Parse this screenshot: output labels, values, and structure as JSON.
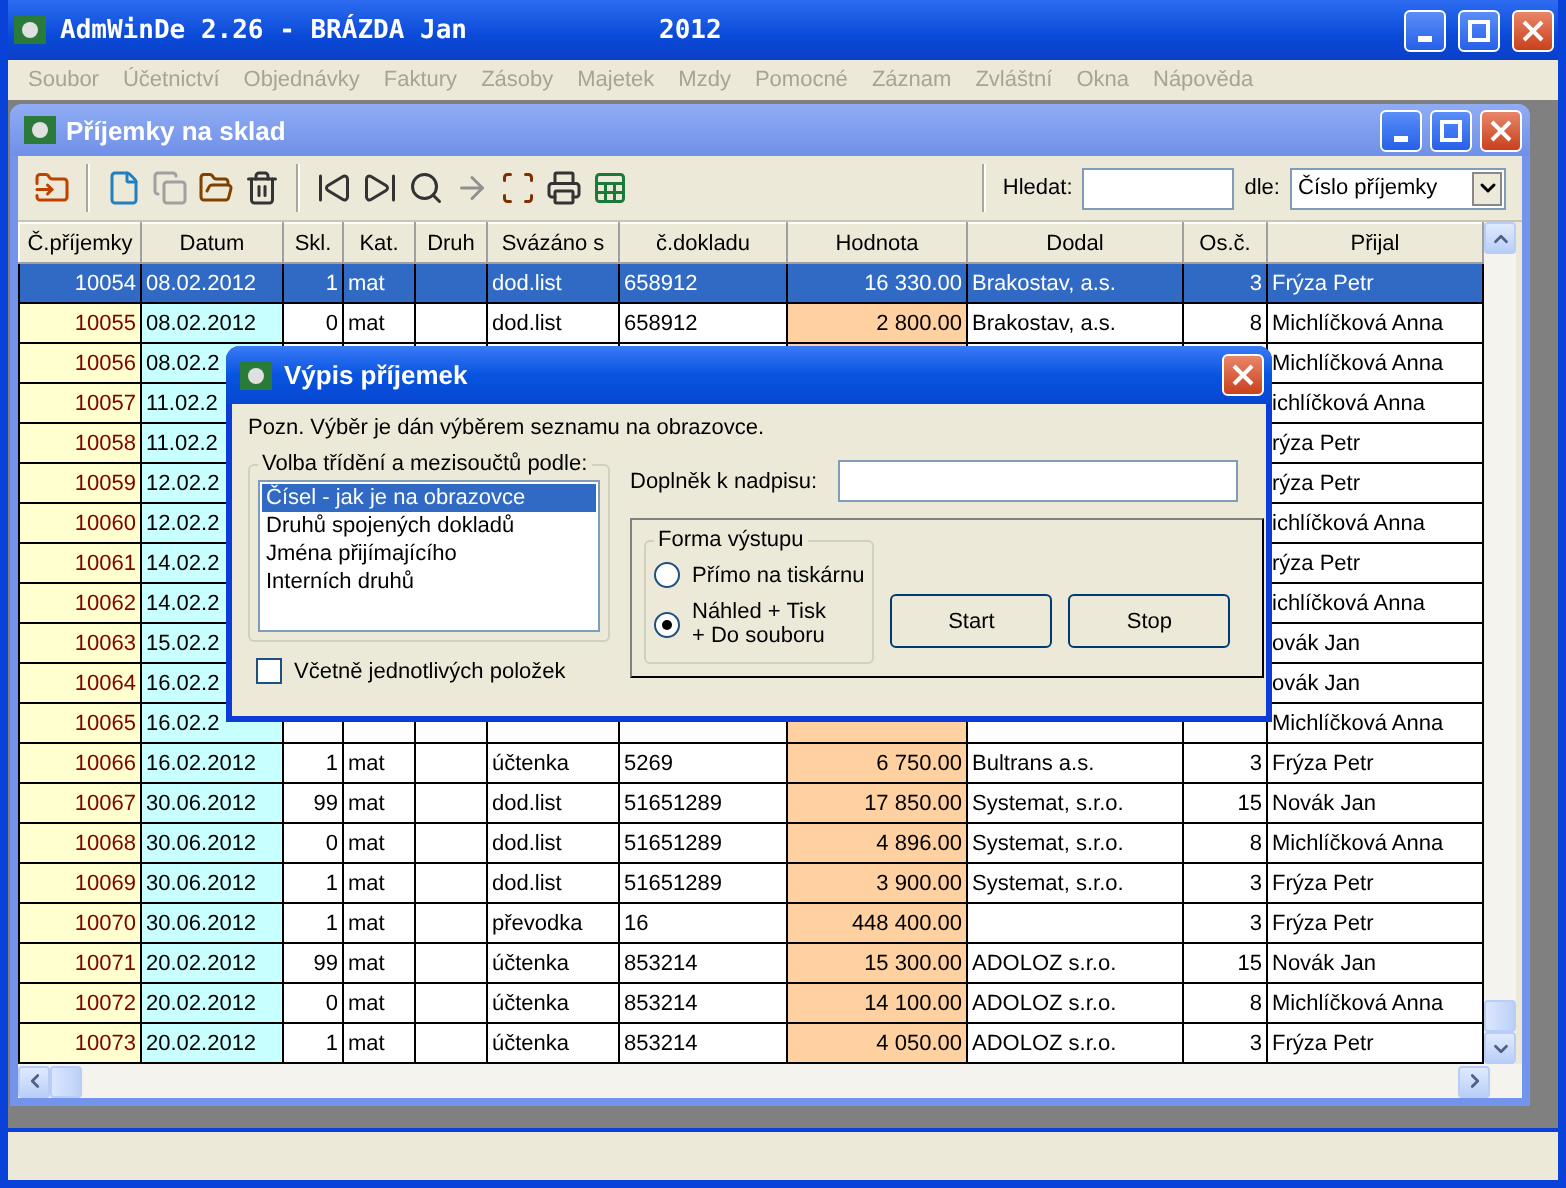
{
  "window": {
    "title": "AdmWinDe 2.26 - BRÁZDA Jan",
    "year": "2012"
  },
  "menu": [
    {
      "label": "Soubor",
      "disabled": true
    },
    {
      "label": "Účetnictví",
      "disabled": true
    },
    {
      "label": "Objednávky",
      "disabled": true
    },
    {
      "label": "Faktury",
      "disabled": true
    },
    {
      "label": "Zásoby",
      "disabled": true
    },
    {
      "label": "Majetek",
      "disabled": true
    },
    {
      "label": "Mzdy",
      "disabled": true
    },
    {
      "label": "Pomocné",
      "disabled": true
    },
    {
      "label": "Záznam",
      "disabled": true
    },
    {
      "label": "Zvláštní",
      "disabled": true
    },
    {
      "label": "Okna",
      "disabled": true
    },
    {
      "label": "Nápověda",
      "disabled": true
    }
  ],
  "child_window": {
    "title": "Příjemky na sklad"
  },
  "search": {
    "label": "Hledat:",
    "by_label": "dle:",
    "by_value": "Číslo příjemky"
  },
  "table": {
    "columns": [
      "Č.příjemky",
      "Datum",
      "Skl.",
      "Kat.",
      "Druh",
      "Svázáno s",
      "č.dokladu",
      "Hodnota",
      "Dodal",
      "Os.č.",
      "Přijal"
    ],
    "rows": [
      {
        "selected": true,
        "number": "10054",
        "date": "08.02.2012",
        "warehouse": "1",
        "category": "mat",
        "linked_to": "dod.list",
        "document_no": "658912",
        "value": "16 330.00",
        "supplier": "Brakostav, a.s.",
        "person_no": "3",
        "received_by": "Frýza Petr"
      },
      {
        "selected": false,
        "number": "10055",
        "date": "08.02.2012",
        "warehouse": "0",
        "category": "mat",
        "linked_to": "dod.list",
        "document_no": "658912",
        "value": "2 800.00",
        "supplier": "Brakostav, a.s.",
        "person_no": "8",
        "received_by": "Michlíčková Anna"
      },
      {
        "selected": false,
        "number": "10056",
        "date": "08.02.2",
        "received_by": "Michlíčková Anna"
      },
      {
        "selected": false,
        "number": "10057",
        "date": "11.02.2",
        "received_by": "ichlíčková Anna"
      },
      {
        "selected": false,
        "number": "10058",
        "date": "11.02.2",
        "received_by": "rýza Petr"
      },
      {
        "selected": false,
        "number": "10059",
        "date": "12.02.2",
        "received_by": "rýza Petr"
      },
      {
        "selected": false,
        "number": "10060",
        "date": "12.02.2",
        "received_by": "ichlíčková Anna"
      },
      {
        "selected": false,
        "number": "10061",
        "date": "14.02.2",
        "received_by": "rýza Petr"
      },
      {
        "selected": false,
        "number": "10062",
        "date": "14.02.2",
        "received_by": "ichlíčková Anna"
      },
      {
        "selected": false,
        "number": "10063",
        "date": "15.02.2",
        "received_by": "ovák Jan"
      },
      {
        "selected": false,
        "number": "10064",
        "date": "16.02.2",
        "received_by": "ovák Jan"
      },
      {
        "selected": false,
        "number": "10065",
        "date": "16.02.2",
        "received_by": "Michlíčková Anna"
      },
      {
        "selected": false,
        "number": "10066",
        "date": "16.02.2012",
        "warehouse": "1",
        "category": "mat",
        "linked_to": "účtenka",
        "document_no": "5269",
        "value": "6 750.00",
        "supplier": "Bultrans a.s.",
        "person_no": "3",
        "received_by": "Frýza Petr"
      },
      {
        "selected": false,
        "number": "10067",
        "date": "30.06.2012",
        "warehouse": "99",
        "category": "mat",
        "linked_to": "dod.list",
        "document_no": "51651289",
        "value": "17 850.00",
        "supplier": "Systemat, s.r.o.",
        "person_no": "15",
        "received_by": "Novák Jan"
      },
      {
        "selected": false,
        "number": "10068",
        "date": "30.06.2012",
        "warehouse": "0",
        "category": "mat",
        "linked_to": "dod.list",
        "document_no": "51651289",
        "value": "4 896.00",
        "supplier": "Systemat, s.r.o.",
        "person_no": "8",
        "received_by": "Michlíčková Anna"
      },
      {
        "selected": false,
        "number": "10069",
        "date": "30.06.2012",
        "warehouse": "1",
        "category": "mat",
        "linked_to": "dod.list",
        "document_no": "51651289",
        "value": "3 900.00",
        "supplier": "Systemat, s.r.o.",
        "person_no": "3",
        "received_by": "Frýza Petr"
      },
      {
        "selected": false,
        "number": "10070",
        "date": "30.06.2012",
        "warehouse": "1",
        "category": "mat",
        "linked_to": "převodka",
        "document_no": "16",
        "value": "448 400.00",
        "person_no": "3",
        "received_by": "Frýza Petr"
      },
      {
        "selected": false,
        "number": "10071",
        "date": "20.02.2012",
        "warehouse": "99",
        "category": "mat",
        "linked_to": "účtenka",
        "document_no": "853214",
        "value": "15 300.00",
        "supplier": "ADOLOZ s.r.o.",
        "person_no": "15",
        "received_by": "Novák Jan"
      },
      {
        "selected": false,
        "number": "10072",
        "date": "20.02.2012",
        "warehouse": "0",
        "category": "mat",
        "linked_to": "účtenka",
        "document_no": "853214",
        "value": "14 100.00",
        "supplier": "ADOLOZ s.r.o.",
        "person_no": "8",
        "received_by": "Michlíčková Anna"
      },
      {
        "selected": false,
        "number": "10073",
        "date": "20.02.2012",
        "warehouse": "1",
        "category": "mat",
        "linked_to": "účtenka",
        "document_no": "853214",
        "value": "4 050.00",
        "supplier": "ADOLOZ s.r.o.",
        "person_no": "3",
        "received_by": "Frýza Petr"
      }
    ]
  },
  "dialog": {
    "title": "Výpis příjemek",
    "note": "Pozn. Výběr je dán výběrem seznamu na obrazovce.",
    "sort_group": {
      "legend": "Volba třídění a mezisoučtů podle:",
      "options": [
        {
          "label": "Čísel - jak je na obrazovce",
          "selected": true
        },
        {
          "label": "Druhů spojených dokladů",
          "selected": false
        },
        {
          "label": "Jména přijímajícího",
          "selected": false
        },
        {
          "label": "Interních druhů",
          "selected": false
        }
      ]
    },
    "include_items": {
      "label": "Včetně jednotlivých položek",
      "checked": false
    },
    "heading_suffix": {
      "label": "Doplněk k nadpisu:"
    },
    "output": {
      "legend": "Forma výstupu",
      "options": [
        {
          "label": "Přímo na tiskárnu",
          "selected": false
        },
        {
          "label": "Náhled + Tisk\n+ Do souboru",
          "selected": true
        }
      ]
    },
    "buttons": [
      "Start",
      "Stop"
    ]
  }
}
